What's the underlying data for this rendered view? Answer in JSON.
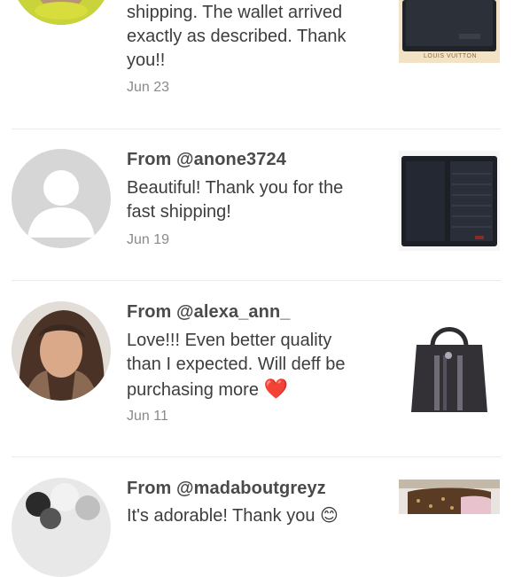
{
  "reviews": [
    {
      "from": "",
      "text_lines": [
        "shipping. The wallet arrived",
        "exactly as described. Thank",
        "you!!"
      ],
      "date": "Jun 23",
      "avatar_icon": "user-photo-avatar",
      "thumb_icon": "black-wallet-photo",
      "thumb_caption": "LOUIS VUITTON"
    },
    {
      "from": "From @anone3724",
      "text_lines": [
        "Beautiful! Thank you for the",
        "fast shipping!"
      ],
      "date": "Jun 19",
      "avatar_icon": "default-user-avatar",
      "thumb_icon": "open-wallet-photo"
    },
    {
      "from": "From @alexa_ann_",
      "text_lines": [
        "Love!!! Even better quality",
        "than I expected. Will deff be",
        "purchasing more"
      ],
      "emoji": "❤️",
      "date": "Jun 11",
      "avatar_icon": "user-photo-avatar",
      "thumb_icon": "tote-bag-photo"
    },
    {
      "from": "From @madaboutgreyz",
      "text_lines": [
        "It's adorable! Thank you 😊"
      ],
      "date": "",
      "avatar_icon": "user-photo-avatar",
      "thumb_icon": "monogram-bag-photo"
    }
  ],
  "colors": {
    "divider": "#ececec",
    "heart": "#e02222",
    "date": "#8a8a8a"
  }
}
